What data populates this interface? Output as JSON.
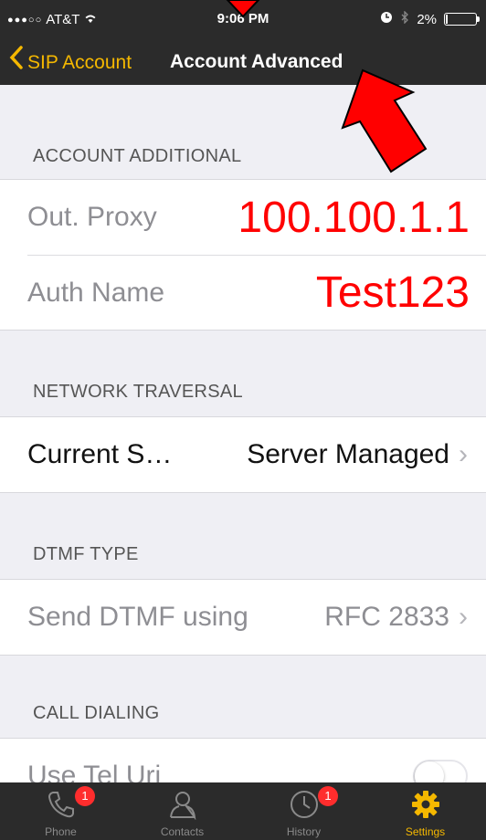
{
  "status_bar": {
    "signal": "●●●○○",
    "carrier": "AT&T",
    "wifi": "wifi-icon",
    "time": "9:06 PM",
    "battery": "2%",
    "battery_level": 0.02
  },
  "nav": {
    "back_label": "SIP Account",
    "title": "Account Advanced"
  },
  "sections": {
    "account_additional": {
      "header": "ACCOUNT ADDITIONAL",
      "out_proxy_label": "Out. Proxy",
      "out_proxy_value": "100.100.1.1",
      "auth_name_label": "Auth Name",
      "auth_name_value": "Test123"
    },
    "network_traversal": {
      "header": "NETWORK TRAVERSAL",
      "label": "Current S…",
      "value": "Server Managed"
    },
    "dtmf_type": {
      "header": "DTMF TYPE",
      "label": "Send DTMF using",
      "value": "RFC 2833"
    },
    "call_dialing": {
      "header": "CALL DIALING",
      "label": "Use Tel Uri",
      "toggle_on": false
    }
  },
  "tabbar": {
    "items": [
      {
        "label": "Phone",
        "icon": "phone-icon",
        "badge": "1"
      },
      {
        "label": "Contacts",
        "icon": "contacts-icon",
        "badge": ""
      },
      {
        "label": "History",
        "icon": "clock-icon",
        "badge": "1"
      },
      {
        "label": "Settings",
        "icon": "gear-icon",
        "badge": ""
      }
    ],
    "active_index": 3
  },
  "colors": {
    "accent": "#f5b800",
    "annotation": "#ff0000",
    "bar": "#2b2b2b",
    "background": "#efeff4"
  }
}
